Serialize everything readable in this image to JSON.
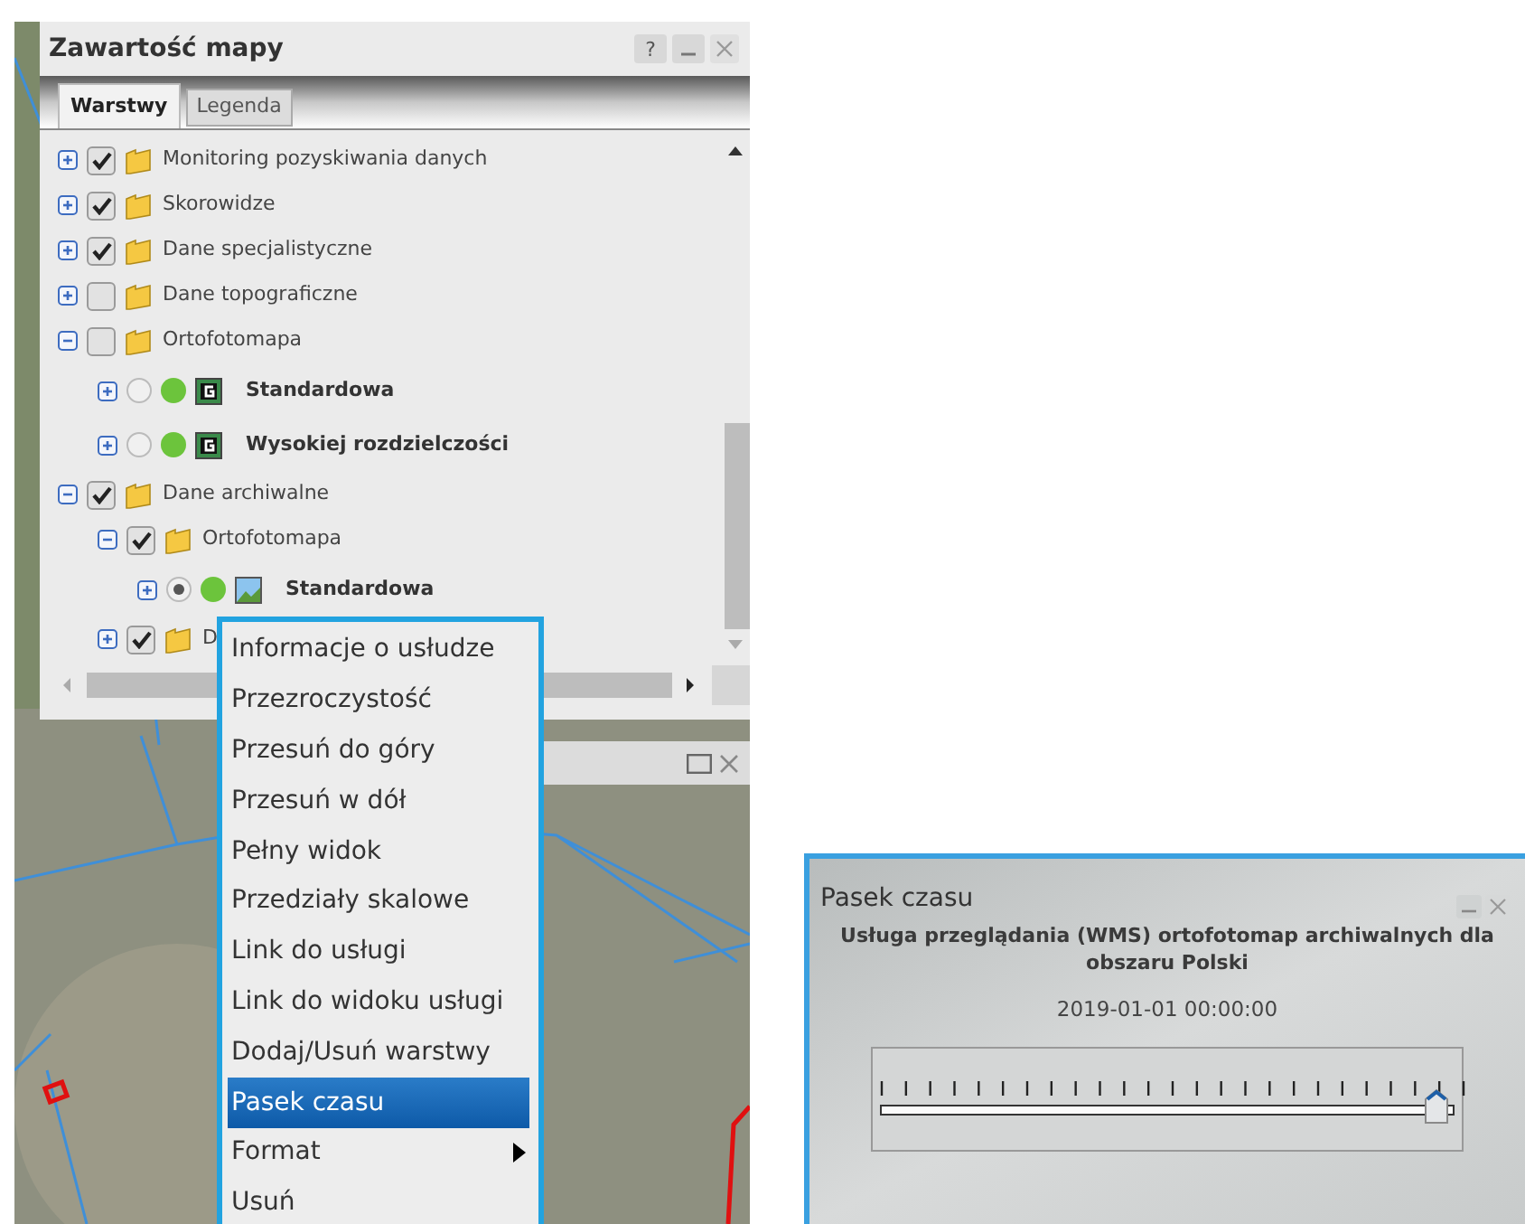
{
  "map_contents_window": {
    "title": "Zawartość mapy",
    "help_button": "?",
    "tabs": [
      {
        "label": "Warstwy",
        "selected": true
      },
      {
        "label": "Legenda",
        "selected": false
      }
    ],
    "layers": [
      {
        "kind": "folder",
        "label": "Monitoring pozyskiwania danych",
        "checked": true,
        "expanded": false
      },
      {
        "kind": "folder",
        "label": "Skorowidze",
        "checked": true,
        "expanded": false
      },
      {
        "kind": "folder",
        "label": "Dane specjalistyczne",
        "checked": true,
        "expanded": false
      },
      {
        "kind": "folder",
        "label": "Dane topograficzne",
        "checked": false,
        "expanded": false
      },
      {
        "kind": "folder",
        "label": "Ortofotomapa",
        "checked": false,
        "expanded": true,
        "children": [
          {
            "kind": "service",
            "label": "Standardowa",
            "selected": false,
            "expanded": false
          },
          {
            "kind": "service",
            "label": "Wysokiej rozdzielczości",
            "selected": false,
            "expanded": false
          }
        ]
      },
      {
        "kind": "folder",
        "label": "Dane archiwalne",
        "checked": true,
        "expanded": true,
        "children": [
          {
            "kind": "folder",
            "label": "Ortofotomapa",
            "checked": true,
            "expanded": true,
            "children": [
              {
                "kind": "image-service",
                "label": "Standardowa",
                "selected": true,
                "expanded": false
              }
            ]
          },
          {
            "kind": "folder",
            "label": "D",
            "checked": true,
            "expanded": false
          }
        ]
      }
    ]
  },
  "context_menu": [
    {
      "label": "Informacje o usłudze",
      "selected": false,
      "submenu": false
    },
    {
      "label": "Przezroczystość",
      "selected": false,
      "submenu": false
    },
    {
      "label": "Przesuń do góry",
      "selected": false,
      "submenu": false
    },
    {
      "label": "Przesuń w dół",
      "selected": false,
      "submenu": false
    },
    {
      "label": "Pełny widok",
      "selected": false,
      "submenu": false
    },
    {
      "label": "Przedziały skalowe",
      "selected": false,
      "submenu": false
    },
    {
      "label": "Link do usługi",
      "selected": false,
      "submenu": false
    },
    {
      "label": "Link do widoku usługi",
      "selected": false,
      "submenu": false
    },
    {
      "label": "Dodaj/Usuń warstwy",
      "selected": false,
      "submenu": false
    },
    {
      "label": "Pasek czasu",
      "selected": true,
      "submenu": false
    },
    {
      "label": "Format",
      "selected": false,
      "submenu": true
    },
    {
      "label": "Usuń",
      "selected": false,
      "submenu": false
    }
  ],
  "time_slider_window": {
    "title": "Pasek czasu",
    "service": "Usługa przeglądania (WMS) ortofotomap archiwalnych dla obszaru Polski",
    "date": "2019-01-01 00:00:00",
    "level": 0.97
  }
}
